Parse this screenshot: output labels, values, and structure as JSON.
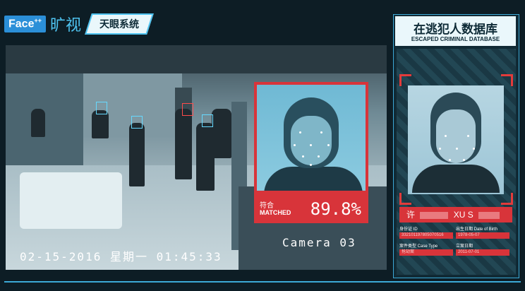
{
  "brand": {
    "logo": "Face",
    "logo_sup": "++",
    "name_cn": "旷视",
    "system": "天眼系统"
  },
  "camera": {
    "datetime": "02-15-2016 星期一 01:45:33",
    "label": "Camera 03"
  },
  "match": {
    "label_cn": "符合",
    "label_en": "MATCHED",
    "score": "89.8%"
  },
  "database": {
    "title": "在逃犯人数据库",
    "subtitle": "ESCAPED CRIMINAL DATABASE",
    "name_prefix": "许",
    "name_mid": "XU S",
    "fields": {
      "id_label": "身份证 ID",
      "id_value": "332101197805070516",
      "birth_label": "出生日期 Date of Birth",
      "birth_value": "1978-05-07",
      "case_label": "案件类型 Case Type",
      "case_value": "抢劫案",
      "date_label": "立案日期",
      "date_value": "2011-07-01"
    }
  },
  "colors": {
    "accent": "#3ca9d6",
    "alert": "#d8343a",
    "face_box": "#66d9ff"
  }
}
